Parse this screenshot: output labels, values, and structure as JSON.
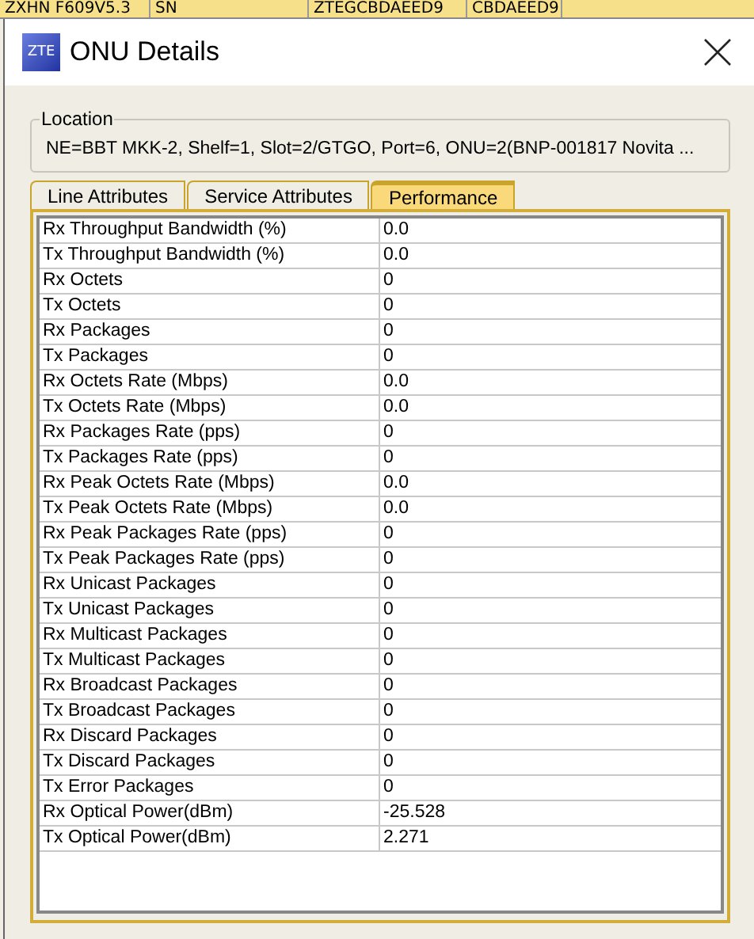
{
  "background_row": [
    "ZXHN F609V5.3",
    "SN",
    "ZTEGCBDAEED9",
    "CBDAEED9"
  ],
  "window": {
    "title": "ONU Details",
    "logo": "ZTE"
  },
  "location": {
    "label": "Location",
    "value": "NE=BBT MKK-2, Shelf=1, Slot=2/GTGO, Port=6, ONU=2(BNP-001817 Novita ..."
  },
  "tabs": [
    {
      "label": "Line Attributes",
      "selected": false
    },
    {
      "label": "Service Attributes",
      "selected": false
    },
    {
      "label": "Performance",
      "selected": true
    }
  ],
  "table": {
    "rows": [
      [
        "Rx Throughput Bandwidth (%)",
        "0.0"
      ],
      [
        "Tx Throughput Bandwidth (%)",
        "0.0"
      ],
      [
        "Rx Octets",
        "0"
      ],
      [
        "Tx Octets",
        "0"
      ],
      [
        "Rx Packages",
        "0"
      ],
      [
        "Tx Packages",
        "0"
      ],
      [
        "Rx Octets Rate (Mbps)",
        "0.0"
      ],
      [
        "Tx Octets Rate (Mbps)",
        "0.0"
      ],
      [
        "Rx Packages Rate (pps)",
        "0"
      ],
      [
        "Tx Packages Rate (pps)",
        "0"
      ],
      [
        "Rx Peak Octets Rate (Mbps)",
        "0.0"
      ],
      [
        "Tx Peak Octets Rate (Mbps)",
        "0.0"
      ],
      [
        "Rx Peak Packages Rate (pps)",
        "0"
      ],
      [
        "Tx Peak Packages Rate (pps)",
        "0"
      ],
      [
        "Rx Unicast Packages",
        "0"
      ],
      [
        "Tx Unicast Packages",
        "0"
      ],
      [
        "Rx Multicast Packages",
        "0"
      ],
      [
        "Tx Multicast Packages",
        "0"
      ],
      [
        "Rx Broadcast Packages",
        "0"
      ],
      [
        "Tx Broadcast Packages",
        "0"
      ],
      [
        "Rx Discard Packages",
        "0"
      ],
      [
        "Tx Discard Packages",
        "0"
      ],
      [
        "Tx Error Packages",
        "0"
      ],
      [
        "Rx Optical Power(dBm)",
        "-25.528"
      ],
      [
        "Tx Optical Power(dBm)",
        "2.271"
      ]
    ]
  }
}
